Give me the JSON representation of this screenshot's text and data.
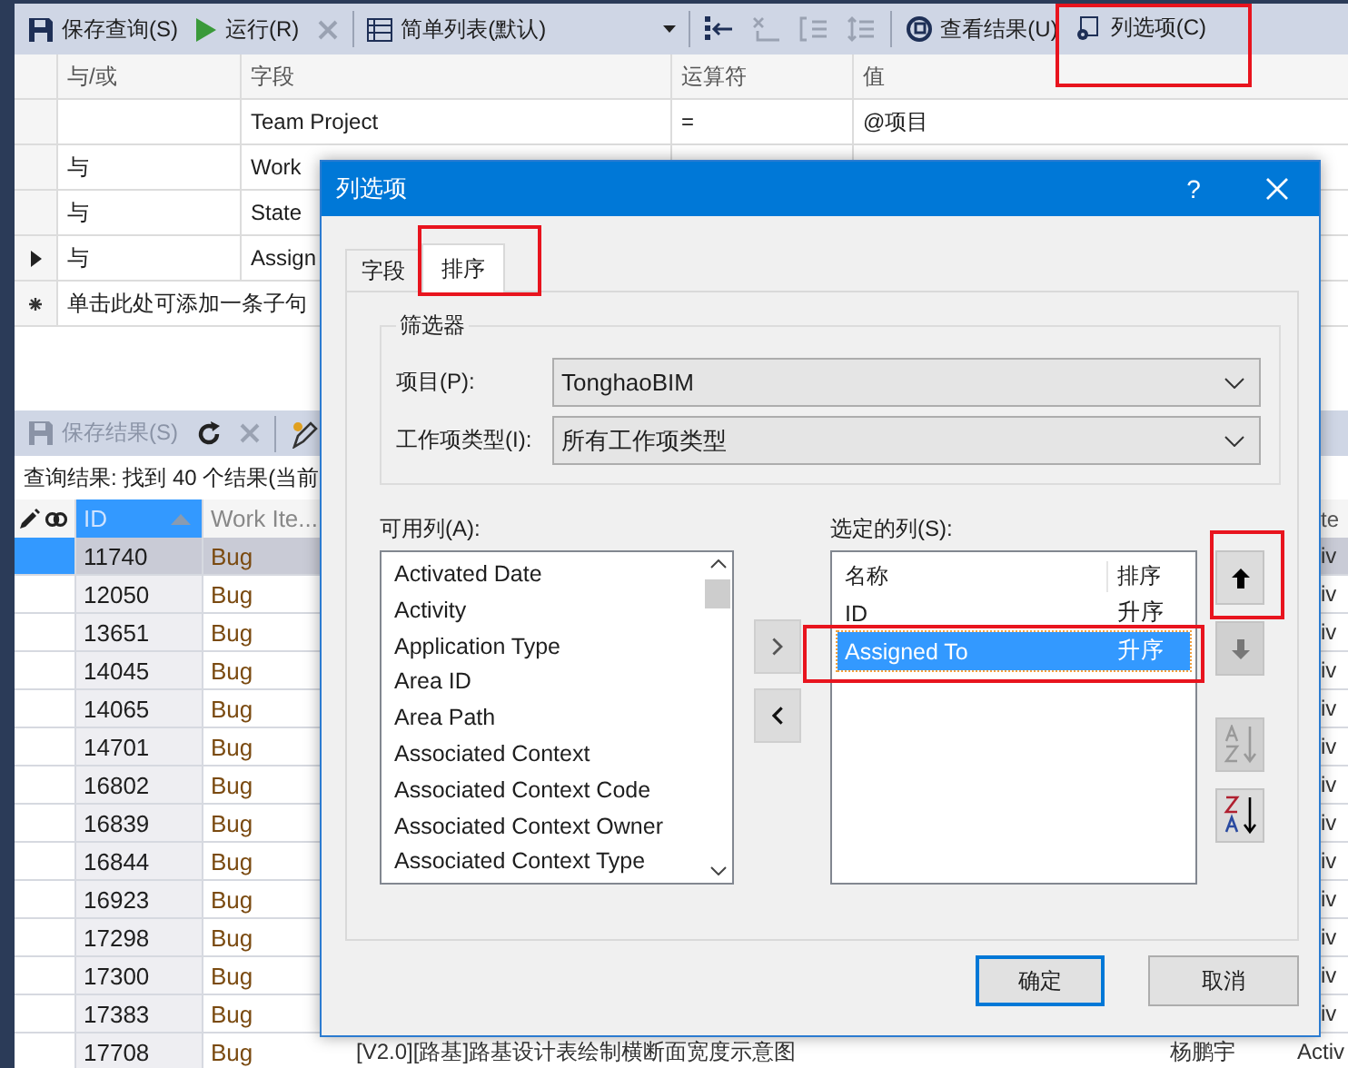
{
  "toolbar": [
    {
      "kind": "save",
      "label": "保存查询(S)",
      "disabled": false
    },
    {
      "kind": "run",
      "label": "运行(R)",
      "disabled": false
    },
    {
      "kind": "stop",
      "disabled": true
    },
    {
      "kind": "separator"
    },
    {
      "kind": "dropdown",
      "label": "简单列表(默认)",
      "disabled": false
    },
    {
      "kind": "separator"
    },
    {
      "kind": "insert",
      "disabled": false
    },
    {
      "kind": "delete",
      "disabled": true
    },
    {
      "kind": "group",
      "disabled": true
    },
    {
      "kind": "ungroup",
      "disabled": true
    },
    {
      "kind": "separator"
    },
    {
      "kind": "results",
      "label": "查看结果(U)",
      "disabled": false
    },
    {
      "kind": "options",
      "label": "列选项(C)",
      "disabled": false,
      "highlighted": true
    }
  ],
  "query": {
    "columns": [
      "与/或",
      "字段",
      "运算符",
      "值"
    ],
    "rows": [
      {
        "current": false,
        "field": "Team Project",
        "operator": "=",
        "value": "@项目"
      },
      {
        "current": false,
        "andor": "与",
        "field": "Work"
      },
      {
        "current": false,
        "andor": "与",
        "field": "State"
      },
      {
        "current": true,
        "andor": "与",
        "field": "Assign"
      }
    ],
    "add_clause": "单击此处可添加一条子句"
  },
  "results_toolbar": [
    {
      "kind": "save",
      "label": "保存结果(S)",
      "disabled": true
    },
    {
      "kind": "refresh",
      "disabled": false
    },
    {
      "kind": "stop",
      "disabled": true
    },
    {
      "kind": "separator"
    },
    {
      "kind": "edit",
      "disabled": false
    }
  ],
  "status": "查询结果: 找到 40 个结果(当前",
  "results": {
    "header": {
      "id": {
        "label": "ID",
        "sorted": true
      },
      "type": {
        "label": "Work Ite..."
      },
      "state": {
        "label": "te"
      }
    },
    "rows": [
      {
        "selected": true,
        "id": "11740",
        "type": "Bug",
        "state": "iv"
      },
      {
        "selected": false,
        "id": "12050",
        "type": "Bug",
        "state": "iv"
      },
      {
        "selected": false,
        "id": "13651",
        "type": "Bug",
        "state": "iv"
      },
      {
        "selected": false,
        "id": "14045",
        "type": "Bug",
        "state": "iv"
      },
      {
        "selected": false,
        "id": "14065",
        "type": "Bug",
        "state": "iv"
      },
      {
        "selected": false,
        "id": "14701",
        "type": "Bug",
        "state": "iv"
      },
      {
        "selected": false,
        "id": "16802",
        "type": "Bug",
        "state": "iv"
      },
      {
        "selected": false,
        "id": "16839",
        "type": "Bug",
        "state": "iv"
      },
      {
        "selected": false,
        "id": "16844",
        "type": "Bug",
        "state": "iv"
      },
      {
        "selected": false,
        "id": "16923",
        "type": "Bug",
        "state": "iv"
      },
      {
        "selected": false,
        "id": "17298",
        "type": "Bug",
        "state": "iv"
      },
      {
        "selected": false,
        "id": "17300",
        "type": "Bug",
        "state": "iv"
      },
      {
        "selected": false,
        "id": "17383",
        "type": "Bug",
        "state": "iv"
      },
      {
        "selected": false,
        "id": "17708",
        "type": "Bug",
        "title": "[V2.0][路基]路基设计表绘制横断面宽度示意图",
        "assigned": "杨鹏宇",
        "state": "Activ"
      }
    ]
  },
  "dialog": {
    "title": "列选项",
    "help": "?",
    "tabs": [
      {
        "label": "字段",
        "selected": false,
        "highlighted": false
      },
      {
        "label": "排序",
        "selected": true,
        "highlighted": true
      }
    ],
    "filter": {
      "legend": "筛选器",
      "project_label": "项目(P):",
      "project": "TonghaoBIM",
      "type_label": "工作项类型(I):",
      "type": "所有工作项类型"
    },
    "available": {
      "label": "可用列(A):",
      "items": [
        "Activated Date",
        "Activity",
        "Application Type",
        "Area ID",
        "Area Path",
        "Associated Context",
        "Associated Context Code",
        "Associated Context Owner",
        "Associated Context Type"
      ]
    },
    "selected_columns": {
      "label": "选定的列(S):",
      "headers": [
        "名称",
        "排序"
      ],
      "rows": [
        {
          "name": "ID",
          "order": "升序",
          "selected": false,
          "highlighted": false
        },
        {
          "name": "Assigned To",
          "order": "升序",
          "selected": true,
          "highlighted": true
        }
      ]
    },
    "move_buttons": [
      {
        "kind": "up",
        "disabled": false,
        "highlighted": true
      },
      {
        "kind": "down",
        "disabled": true,
        "highlighted": false
      },
      {
        "kind": "ascending",
        "disabled": true,
        "highlighted": false
      },
      {
        "kind": "descending",
        "disabled": false,
        "highlighted": false
      }
    ],
    "ok": "确定",
    "cancel": "取消"
  }
}
